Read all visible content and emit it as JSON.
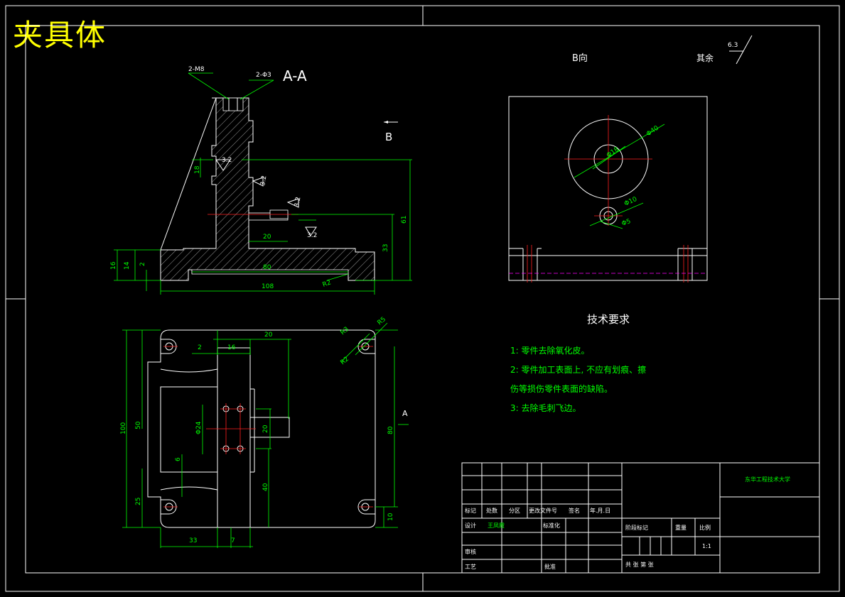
{
  "drawing": {
    "title": "夹具体",
    "section_label": "A-A",
    "view_b_label": "B向",
    "view_arrow_label": "B",
    "arrow_a_label": "A",
    "remaining_label": "其余",
    "remaining_roughness": "6.3"
  },
  "section_view": {
    "labels": {
      "thread_callout": "2-M8",
      "hole_callout": "2-Φ3",
      "dim_16_left": "16",
      "dim_14": "14",
      "dim_2": "2",
      "dim_108": "108",
      "dim_80": "80",
      "dim_20": "20",
      "dim_33": "33",
      "dim_61": "61",
      "dim_r2": "R2",
      "dim_18": "18",
      "roughness_1": "3.2",
      "roughness_2": "3.2",
      "roughness_3": "3.2",
      "roughness_4": "3.2"
    }
  },
  "b_view": {
    "labels": {
      "dia_40": "Φ40",
      "dia_18": "Φ18",
      "dia_10": "Φ10",
      "dia_5": "Φ5"
    }
  },
  "plan_view": {
    "labels": {
      "dim_2": "2",
      "dim_16": "16",
      "dim_20": "20",
      "dim_r5": "R5",
      "dim_r3": "R3",
      "dim_r2": "R2",
      "dim_100": "100",
      "dim_50": "50",
      "dim_24": "Φ24",
      "dim_20b": "20",
      "dim_80": "80",
      "dim_6": "6",
      "dim_40": "40",
      "dim_25": "25",
      "dim_10": "10",
      "dim_33": "33",
      "dim_7": "7"
    }
  },
  "tech_requirements": {
    "title": "技术要求",
    "items": [
      "1: 零件去除氧化皮。",
      "2: 零件加工表面上, 不应有划痕、擦",
      "伤等损伤零件表面的缺陷。",
      "3: 去除毛刺飞边。"
    ]
  },
  "title_block": {
    "school": "东华工程技术大学",
    "row_labels": [
      "标记",
      "处数",
      "分区",
      "更改文件号",
      "签名",
      "年.月.日"
    ],
    "designer_label": "设计",
    "designer_name": "王凤霞",
    "standard_label": "标准化",
    "stage_label": "阶段标记",
    "weight_label": "重量",
    "scale_label": "比例",
    "scale_value": "1:1",
    "review_label": "审核",
    "process_label": "工艺",
    "approve_label": "批准",
    "sheet_label": "共  张  第  张"
  }
}
